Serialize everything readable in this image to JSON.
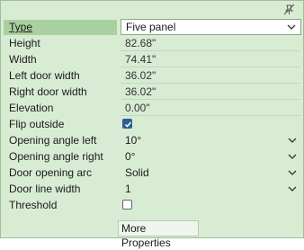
{
  "properties": {
    "type": {
      "label": "Type",
      "value": "Five panel"
    },
    "height": {
      "label": "Height",
      "value": "82.68\""
    },
    "width": {
      "label": "Width",
      "value": "74.41\""
    },
    "left_door_width": {
      "label": "Left door width",
      "value": "36.02\""
    },
    "right_door_width": {
      "label": "Right door width",
      "value": "36.02\""
    },
    "elevation": {
      "label": "Elevation",
      "value": "0.00\""
    },
    "flip_outside": {
      "label": "Flip outside",
      "checked": true
    },
    "opening_angle_left": {
      "label": "Opening angle left",
      "value": "10°"
    },
    "opening_angle_right": {
      "label": "Opening angle right",
      "value": "0°"
    },
    "door_opening_arc": {
      "label": "Door opening arc",
      "value": "Solid"
    },
    "door_line_width": {
      "label": "Door line width",
      "value": "1"
    },
    "threshold": {
      "label": "Threshold",
      "checked": false
    }
  },
  "more_properties_label": "More Properties",
  "icons": {
    "pin": "unpin-icon",
    "dropdown": "chevron-down-icon",
    "check": "checkmark-icon"
  }
}
